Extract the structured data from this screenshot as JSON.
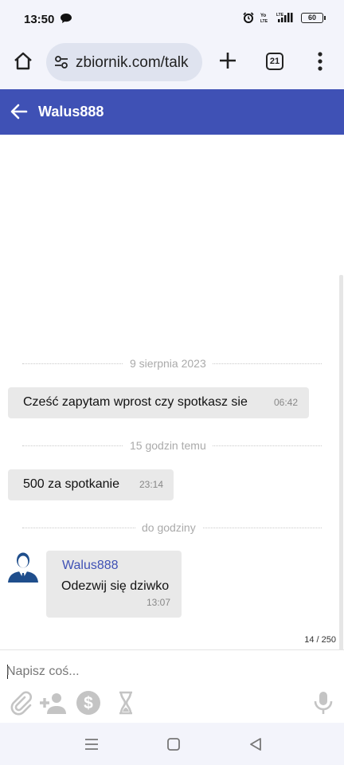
{
  "status_bar": {
    "time": "13:50",
    "battery": "60"
  },
  "browser": {
    "url": "zbiornik.com/talk",
    "tab_count": "21"
  },
  "header": {
    "title": "Walus888"
  },
  "messages": [
    {
      "date_divider": "9 sierpnia 2023",
      "text": "Cześć zapytam wprost czy spotkasz sie",
      "time": "06:42"
    },
    {
      "date_divider": "15 godzin temu",
      "text": "500 za spotkanie",
      "time": "23:14"
    },
    {
      "date_divider": "do godziny",
      "sender": "Walus888",
      "text": "Odezwij się dziwko",
      "time": "13:07"
    }
  ],
  "composer": {
    "placeholder": "Napisz coś...",
    "char_counter": "14 / 250"
  },
  "icons": {
    "status": [
      "chat-bubble-icon",
      "alarm-icon",
      "volte-icon",
      "signal-icon",
      "battery-icon"
    ],
    "browser": [
      "home-icon",
      "site-settings-icon",
      "new-tab-icon",
      "tab-switcher-icon",
      "more-menu-icon"
    ],
    "composer": [
      "attach-icon",
      "add-person-icon",
      "dollar-icon",
      "hourglass-icon",
      "microphone-icon"
    ],
    "nav": [
      "recent-apps-icon",
      "home-nav-icon",
      "back-nav-icon"
    ]
  },
  "colors": {
    "accent": "#3f51b5",
    "bubble": "#e9e9e9",
    "chrome": "#f3f4fb"
  }
}
